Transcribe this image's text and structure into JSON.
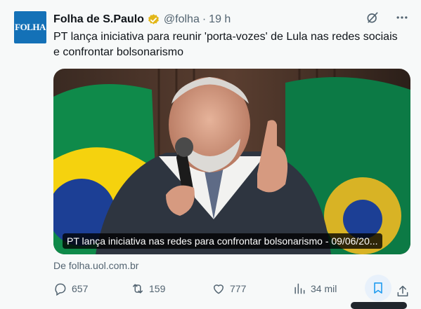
{
  "author": {
    "name": "Folha de S.Paulo",
    "handle": "@folha",
    "separator": "·",
    "time": "19 h",
    "avatar_text": "FOLHA",
    "avatar_color": "#1471b7",
    "verified_color": "#e2b719"
  },
  "tweet_text": "PT lança iniciativa para reunir 'porta-vozes' de Lula nas redes sociais e confrontar bolsonarismo",
  "card": {
    "caption": "PT lança iniciativa nas redes para confrontar bolsonarismo - 09/06/20...",
    "source": "De folha.uol.com.br"
  },
  "actions": {
    "replies": "657",
    "reposts": "159",
    "likes": "777",
    "views": "34 mil"
  },
  "icons": {
    "grok": "grok-icon",
    "more": "more-icon",
    "reply": "reply-icon",
    "repost": "repost-icon",
    "like": "heart-icon",
    "views": "views-icon",
    "bookmark": "bookmark-icon",
    "share": "share-icon"
  },
  "colors": {
    "accent": "#1d9bf0",
    "muted": "#536471"
  }
}
